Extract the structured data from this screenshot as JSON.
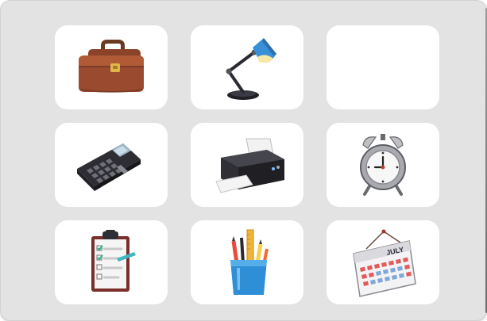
{
  "board": {
    "tiles": [
      {
        "item": "briefcase",
        "revealed": true
      },
      {
        "item": "desk-lamp",
        "revealed": true
      },
      {
        "item": "empty",
        "revealed": false
      },
      {
        "item": "calculator",
        "revealed": true
      },
      {
        "item": "printer",
        "revealed": true
      },
      {
        "item": "alarm-clock",
        "revealed": true
      },
      {
        "item": "clipboard",
        "revealed": true
      },
      {
        "item": "pencil-cup",
        "revealed": true
      },
      {
        "item": "wall-calendar",
        "revealed": true
      }
    ]
  },
  "calendar": {
    "month": "JULY"
  },
  "colors": {
    "board_bg": "#e3e3e3",
    "tile_bg": "#ffffff",
    "lamp_blue": "#3a8fd9",
    "briefcase_brown": "#9a4a2e"
  }
}
